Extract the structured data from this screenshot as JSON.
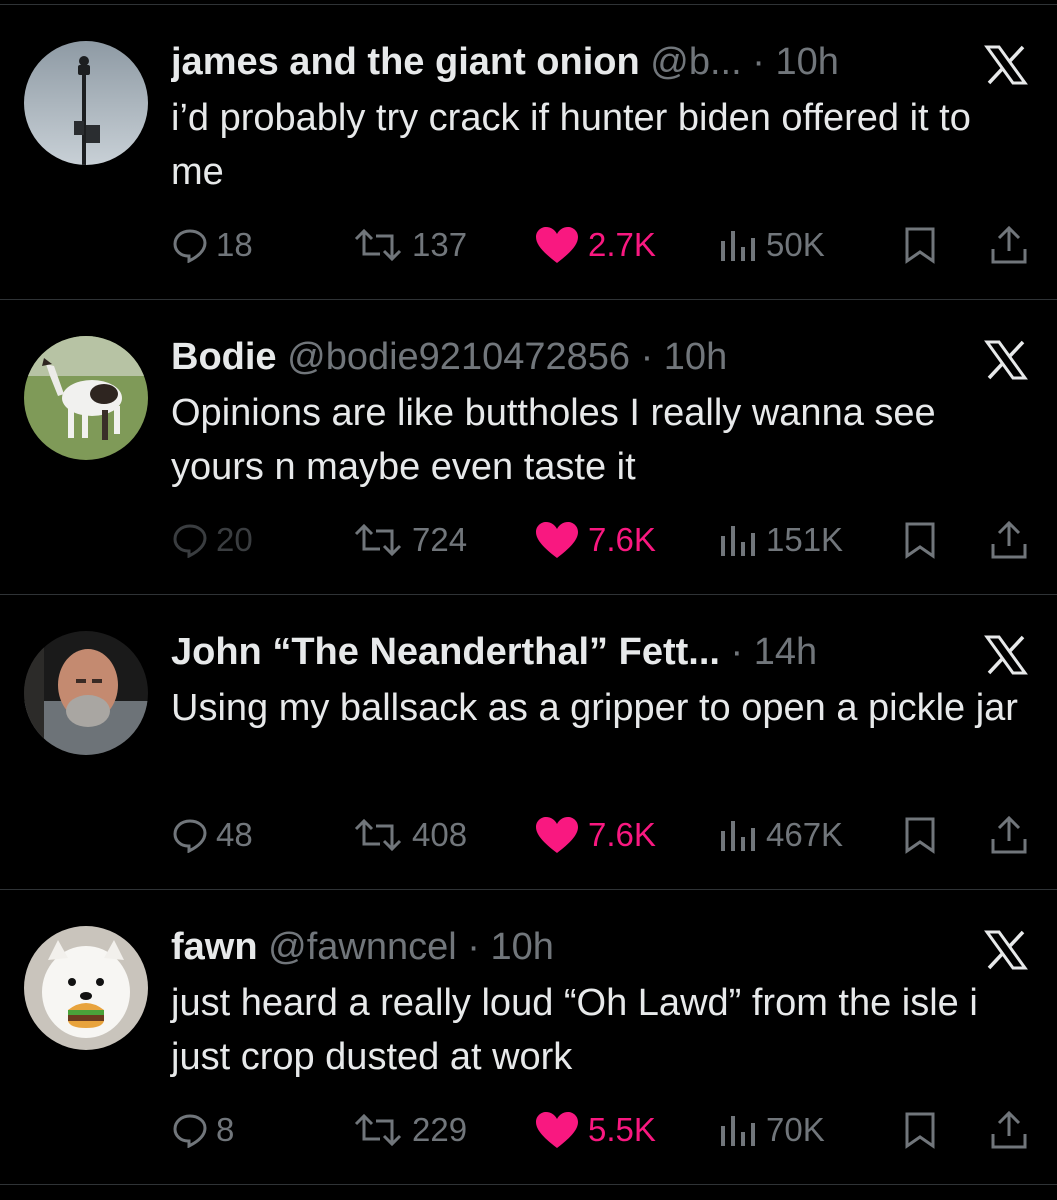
{
  "colors": {
    "background": "#000000",
    "text": "#e7e9ea",
    "secondary": "#71767b",
    "like": "#f91880",
    "divider": "#2f3336"
  },
  "tweets": [
    {
      "name": "james and the giant onion",
      "handle": "@b...",
      "separator": "·",
      "time": "10h",
      "text": "i’d probably try crack if hunter biden offered it to me",
      "avatar_icon": "lamp-post-avatar",
      "replies": "18",
      "retweets": "137",
      "likes": "2.7K",
      "views": "50K"
    },
    {
      "name": "Bodie",
      "handle": "@bodie9210472856",
      "separator": "·",
      "time": "10h",
      "text": "Opinions are like buttholes I really wanna see yours n maybe even taste it",
      "avatar_icon": "horse-avatar",
      "replies": "20",
      "retweets": "724",
      "likes": "7.6K",
      "views": "151K"
    },
    {
      "name": "John “The Neanderthal” Fett...",
      "handle": "",
      "separator": "·",
      "time": "14h",
      "text": "Using my ballsack as a gripper to open a pickle jar",
      "avatar_icon": "man-portrait-avatar",
      "replies": "48",
      "retweets": "408",
      "likes": "7.6K",
      "views": "467K"
    },
    {
      "name": "fawn",
      "handle": "@fawnncel",
      "separator": "·",
      "time": "10h",
      "text": "just heard a really loud “Oh Lawd” from the isle i just crop dusted at work",
      "avatar_icon": "dog-burger-avatar",
      "replies": "8",
      "retweets": "229",
      "likes": "5.5K",
      "views": "70K"
    }
  ]
}
